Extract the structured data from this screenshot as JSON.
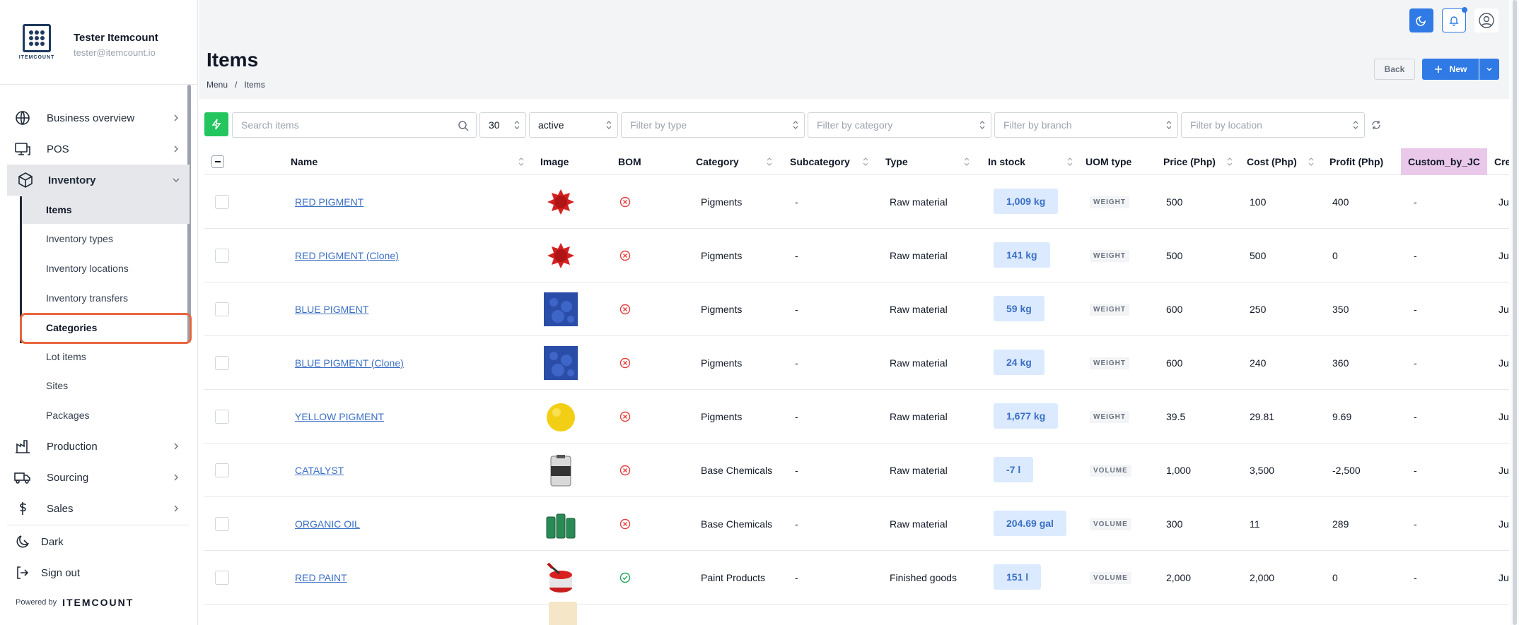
{
  "user": {
    "name": "Tester Itemcount",
    "email": "tester@itemcount.io"
  },
  "logo_text": "ITEMCOUNT",
  "nav": {
    "business_overview": "Business overview",
    "pos": "POS",
    "inventory": "Inventory",
    "inventory_sub": [
      "Items",
      "Inventory types",
      "Inventory locations",
      "Inventory transfers",
      "Categories",
      "Lot items",
      "Sites",
      "Packages"
    ],
    "production": "Production",
    "sourcing": "Sourcing",
    "sales": "Sales",
    "dark": "Dark",
    "sign_out": "Sign out"
  },
  "powered": {
    "label": "Powered by",
    "brand": "ITEMCOUNT"
  },
  "header": {
    "title": "Items",
    "breadcrumb": [
      "Menu",
      "/",
      "Items"
    ],
    "back": "Back",
    "new": "New"
  },
  "filters": {
    "search_placeholder": "Search items",
    "page_size": "30",
    "status": "active",
    "type_placeholder": "Filter by type",
    "category_placeholder": "Filter by category",
    "branch_placeholder": "Filter by branch",
    "location_placeholder": "Filter by location"
  },
  "columns": [
    "Name",
    "Image",
    "BOM",
    "Category",
    "Subcategory",
    "Type",
    "In stock",
    "UOM type",
    "Price (Php)",
    "Cost (Php)",
    "Profit (Php)",
    "Custom_by_JC",
    "Cre"
  ],
  "rows": [
    {
      "name": "RED PIGMENT",
      "image": "red-pigment",
      "bom": "no",
      "category": "Pigments",
      "subcategory": "-",
      "type": "Raw material",
      "stock": "1,009 kg",
      "uom": "WEIGHT",
      "price": "500",
      "cost": "100",
      "profit": "400",
      "custom": "-",
      "created": "Ju"
    },
    {
      "name": "RED PIGMENT (Clone)",
      "image": "red-pigment",
      "bom": "no",
      "category": "Pigments",
      "subcategory": "-",
      "type": "Raw material",
      "stock": "141 kg",
      "uom": "WEIGHT",
      "price": "500",
      "cost": "500",
      "profit": "0",
      "custom": "-",
      "created": "Ju"
    },
    {
      "name": "BLUE PIGMENT",
      "image": "blue-pigment",
      "bom": "no",
      "category": "Pigments",
      "subcategory": "-",
      "type": "Raw material",
      "stock": "59 kg",
      "uom": "WEIGHT",
      "price": "600",
      "cost": "250",
      "profit": "350",
      "custom": "-",
      "created": "Ju"
    },
    {
      "name": "BLUE PIGMENT (Clone)",
      "image": "blue-pigment",
      "bom": "no",
      "category": "Pigments",
      "subcategory": "-",
      "type": "Raw material",
      "stock": "24 kg",
      "uom": "WEIGHT",
      "price": "600",
      "cost": "240",
      "profit": "360",
      "custom": "-",
      "created": "Ju"
    },
    {
      "name": "YELLOW PIGMENT",
      "image": "yellow-pigment",
      "bom": "no",
      "category": "Pigments",
      "subcategory": "-",
      "type": "Raw material",
      "stock": "1,677 kg",
      "uom": "WEIGHT",
      "price": "39.5",
      "cost": "29.81",
      "profit": "9.69",
      "custom": "-",
      "created": "Ju"
    },
    {
      "name": "CATALYST",
      "image": "catalyst-jug",
      "bom": "no",
      "category": "Base Chemicals",
      "subcategory": "-",
      "type": "Raw material",
      "stock": "-7 l",
      "uom": "VOLUME",
      "price": "1,000",
      "cost": "3,500",
      "profit": "-2,500",
      "custom": "-",
      "created": "Ju"
    },
    {
      "name": "ORGANIC OIL",
      "image": "oil-drums",
      "bom": "no",
      "category": "Base Chemicals",
      "subcategory": "-",
      "type": "Raw material",
      "stock": "204.69 gal",
      "uom": "VOLUME",
      "price": "300",
      "cost": "11",
      "profit": "289",
      "custom": "-",
      "created": "Ju"
    },
    {
      "name": "RED PAINT",
      "image": "paint-can",
      "bom": "yes",
      "category": "Paint Products",
      "subcategory": "-",
      "type": "Finished goods",
      "stock": "151 l",
      "uom": "VOLUME",
      "price": "2,000",
      "cost": "2,000",
      "profit": "0",
      "custom": "-",
      "created": "Ju"
    }
  ],
  "colors": {
    "accent": "#2f7ae5",
    "success": "#22c55e",
    "link": "#3b6fc4",
    "highlight": "#e8663d",
    "custom_col": "#e9c8ea"
  }
}
